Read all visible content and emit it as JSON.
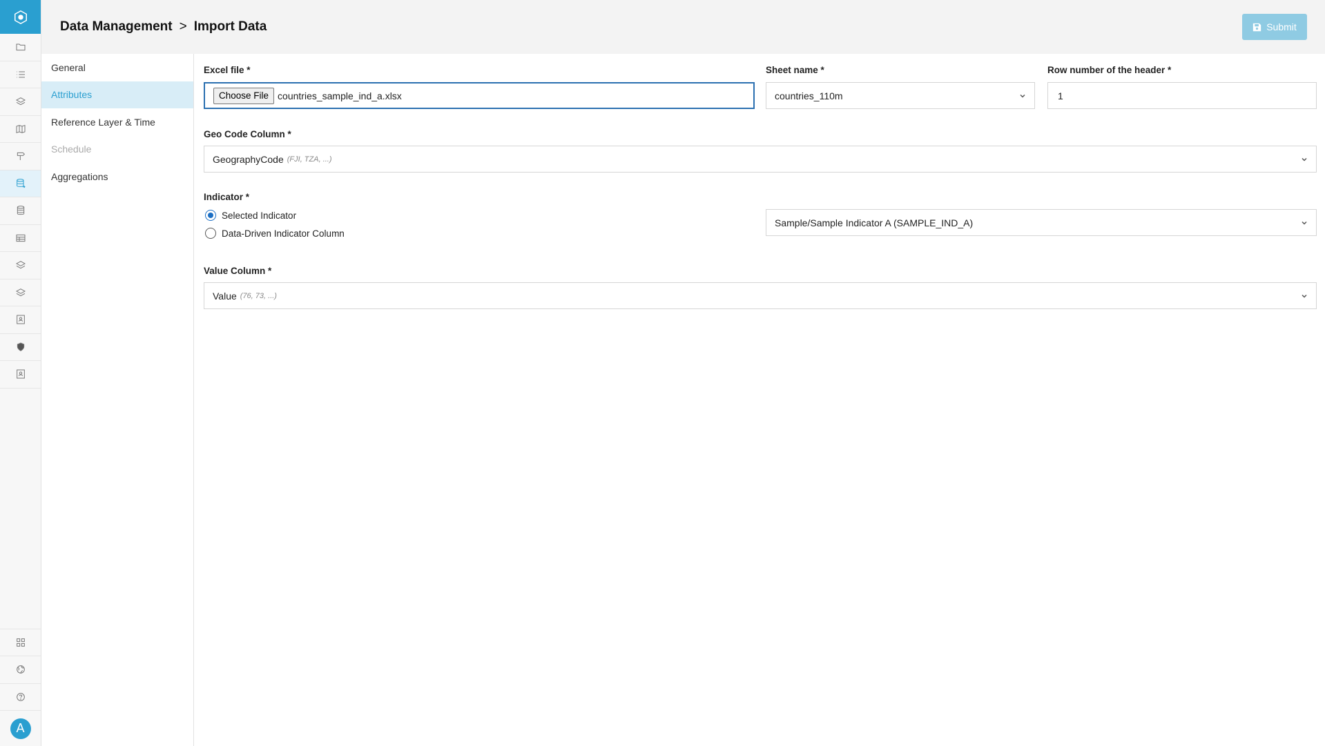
{
  "rail": {
    "logo_icon": "app-logo-icon",
    "items": [
      {
        "icon": "folder-icon"
      },
      {
        "icon": "list-icon"
      },
      {
        "icon": "layers-icon"
      },
      {
        "icon": "map-icon"
      },
      {
        "icon": "signpost-icon"
      },
      {
        "icon": "database-import-icon",
        "active": true
      },
      {
        "icon": "database-icon"
      },
      {
        "icon": "table-icon"
      },
      {
        "icon": "layers-icon"
      },
      {
        "icon": "layers-icon"
      },
      {
        "icon": "contact-card-icon"
      },
      {
        "icon": "shield-icon"
      },
      {
        "icon": "contact-card-icon"
      }
    ],
    "bottom_items": [
      {
        "icon": "grid-icon"
      },
      {
        "icon": "globe-icon"
      },
      {
        "icon": "help-icon"
      }
    ],
    "avatar_letter": "A",
    "accent": "#2a9fd0"
  },
  "header": {
    "breadcrumb_parent": "Data Management",
    "breadcrumb_sep": ">",
    "breadcrumb_current": "Import Data",
    "submit_label": "Submit"
  },
  "secnav": {
    "items": [
      {
        "label": "General",
        "state": "normal"
      },
      {
        "label": "Attributes",
        "state": "active"
      },
      {
        "label": "Reference Layer & Time",
        "state": "normal"
      },
      {
        "label": "Schedule",
        "state": "disabled"
      },
      {
        "label": "Aggregations",
        "state": "normal"
      }
    ]
  },
  "form": {
    "excel_file": {
      "label": "Excel file *",
      "button": "Choose File",
      "value": "countries_sample_ind_a.xlsx"
    },
    "sheet_name": {
      "label": "Sheet name *",
      "value": "countries_110m"
    },
    "header_row": {
      "label": "Row number of the header *",
      "value": "1"
    },
    "geo_code": {
      "label": "Geo Code Column *",
      "value": "GeographyCode",
      "hint": "(FJI, TZA, ...)"
    },
    "indicator": {
      "label": "Indicator *",
      "options": [
        {
          "label": "Selected Indicator",
          "checked": true
        },
        {
          "label": "Data-Driven Indicator Column",
          "checked": false
        }
      ],
      "selected_value": "Sample/Sample Indicator A (SAMPLE_IND_A)"
    },
    "value_column": {
      "label": "Value Column *",
      "value": "Value",
      "hint": "(76, 73, ...)"
    }
  }
}
